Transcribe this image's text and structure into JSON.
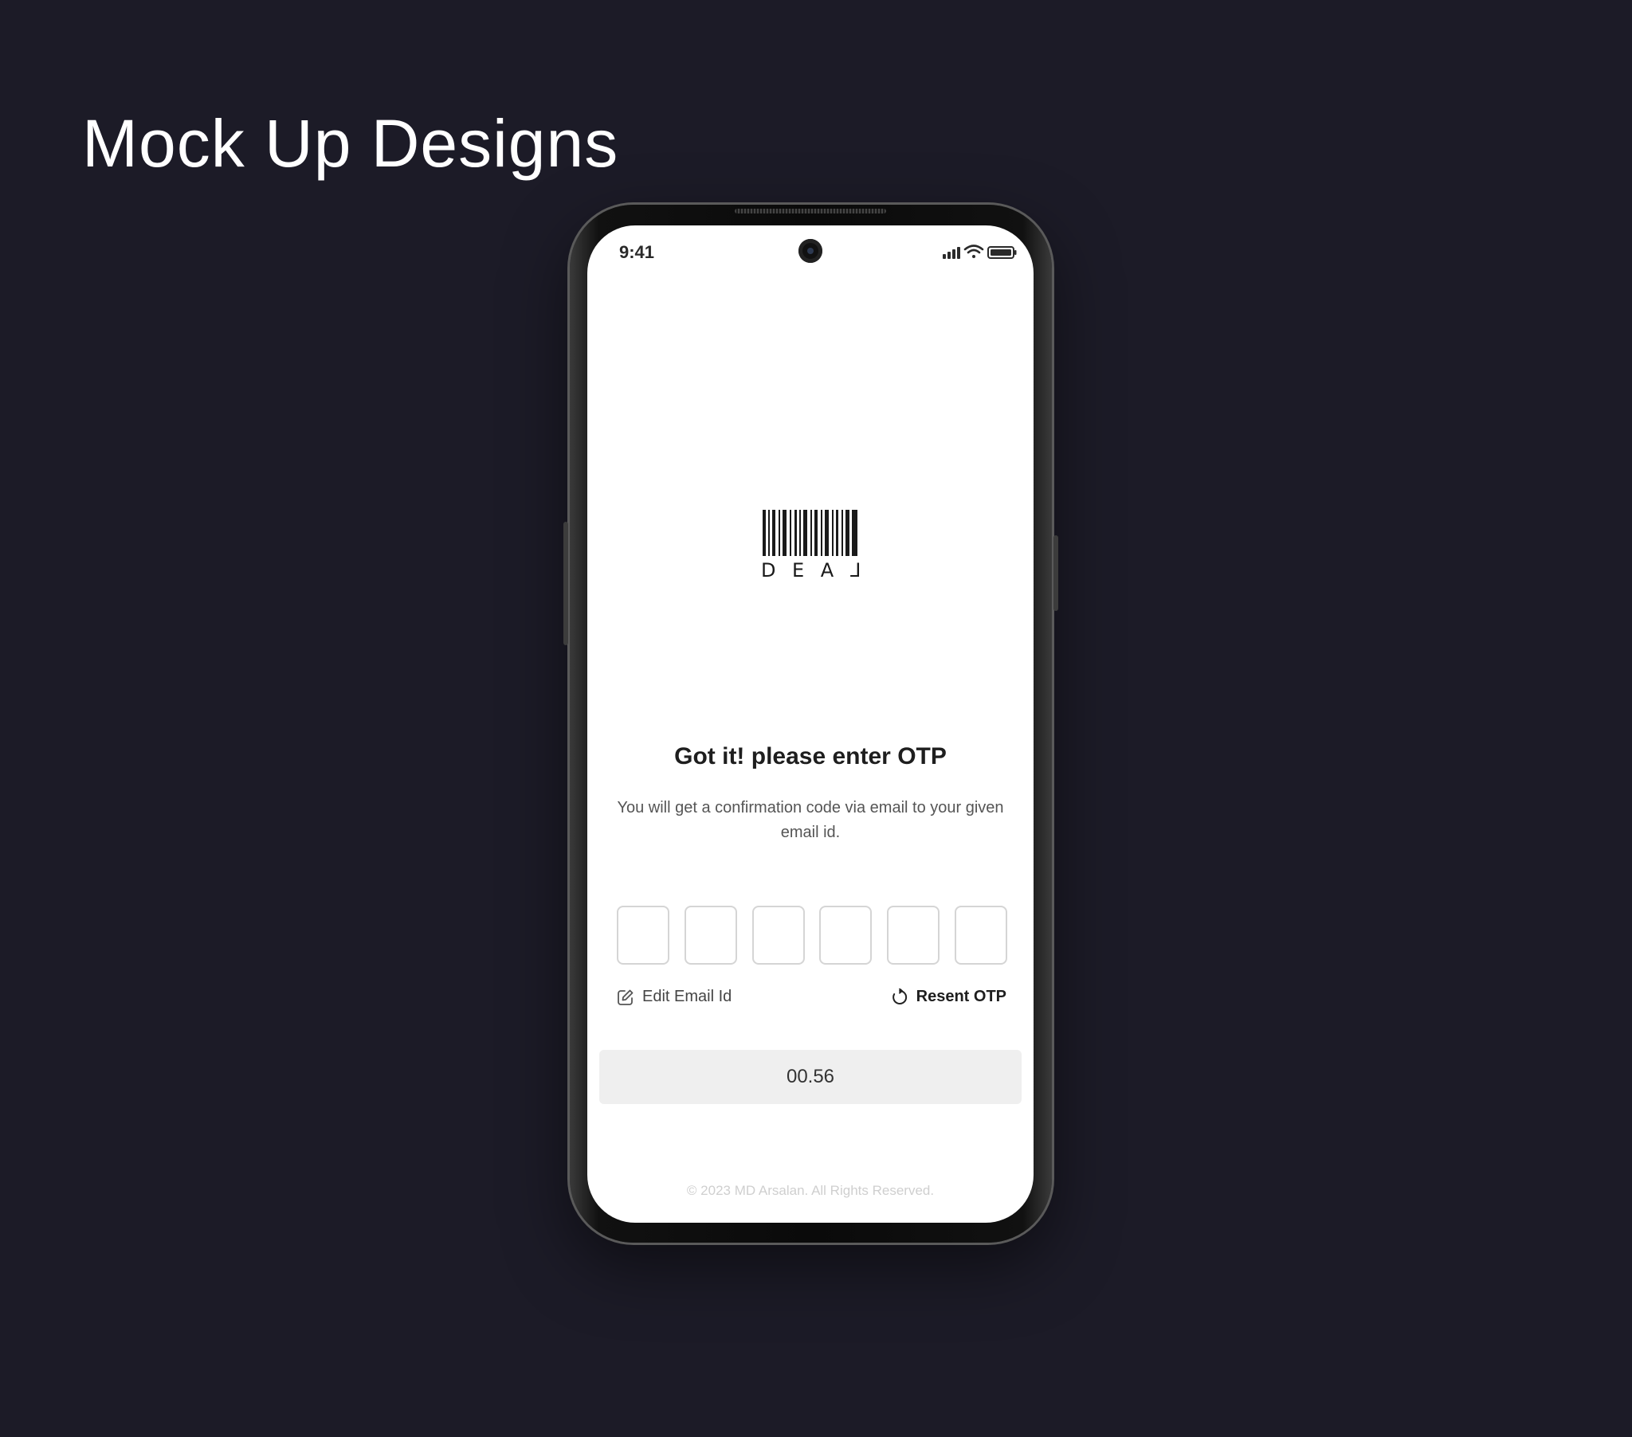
{
  "page": {
    "heading": "Mock Up Designs"
  },
  "status_bar": {
    "time": "9:41",
    "icons": [
      "signal-icon",
      "wifi-icon",
      "battery-icon"
    ]
  },
  "logo": {
    "text_letters": [
      "D",
      "E",
      "A",
      "L"
    ]
  },
  "otp_screen": {
    "title": "Got it! please enter OTP",
    "subtitle": "You will get a confirmation code via email to your given email id.",
    "otp_fields": [
      "",
      "",
      "",
      "",
      "",
      ""
    ],
    "edit_email_label": "Edit Email Id",
    "resend_label": "Resent OTP",
    "timer": "00.56",
    "footer": "© 2023 MD Arsalan. All Rights Reserved."
  },
  "colors": {
    "background": "#1c1b27",
    "screen": "#ffffff",
    "timer_bar": "#efefef",
    "otp_border": "#d5d5d5"
  }
}
